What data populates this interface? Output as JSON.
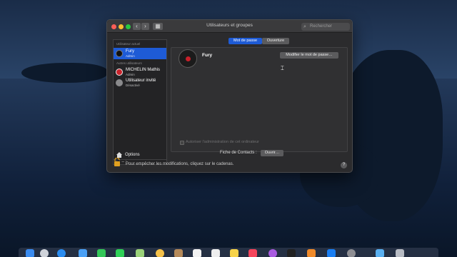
{
  "window": {
    "title": "Utilisateurs et groupes",
    "search_placeholder": "Rechercher"
  },
  "sidebar": {
    "current_user_section": "Utilisateur actuel",
    "other_users_section": "Autres utilisateurs",
    "current_user": {
      "name": "Fury",
      "role": "Admin"
    },
    "other_users": [
      {
        "name": "MICHELIN Mathis",
        "role": "Admin"
      },
      {
        "name": "Utilisateur invité",
        "role": "Désactivé"
      }
    ],
    "options_label": "Options",
    "add_label": "+",
    "remove_label": "−"
  },
  "tabs": [
    {
      "label": "Mot de passe",
      "selected": true
    },
    {
      "label": "Ouverture",
      "selected": false
    }
  ],
  "user_panel": {
    "name": "Fury",
    "change_password_button": "Modifier le mot de passe…",
    "contact_card_label": "Fiche de Contacts :",
    "open_button": "Ouvrir…",
    "admin_checkbox_label": "Autoriser l'administration de cet ordinateur"
  },
  "footer": {
    "lock_text": "Pour empêcher les modifications, cliquez sur le cadenas.",
    "help_label": "?"
  },
  "colors": {
    "selection": "#1e5bd6",
    "close": "#fe5f57",
    "minimize": "#febc2e",
    "zoom": "#28c840"
  }
}
